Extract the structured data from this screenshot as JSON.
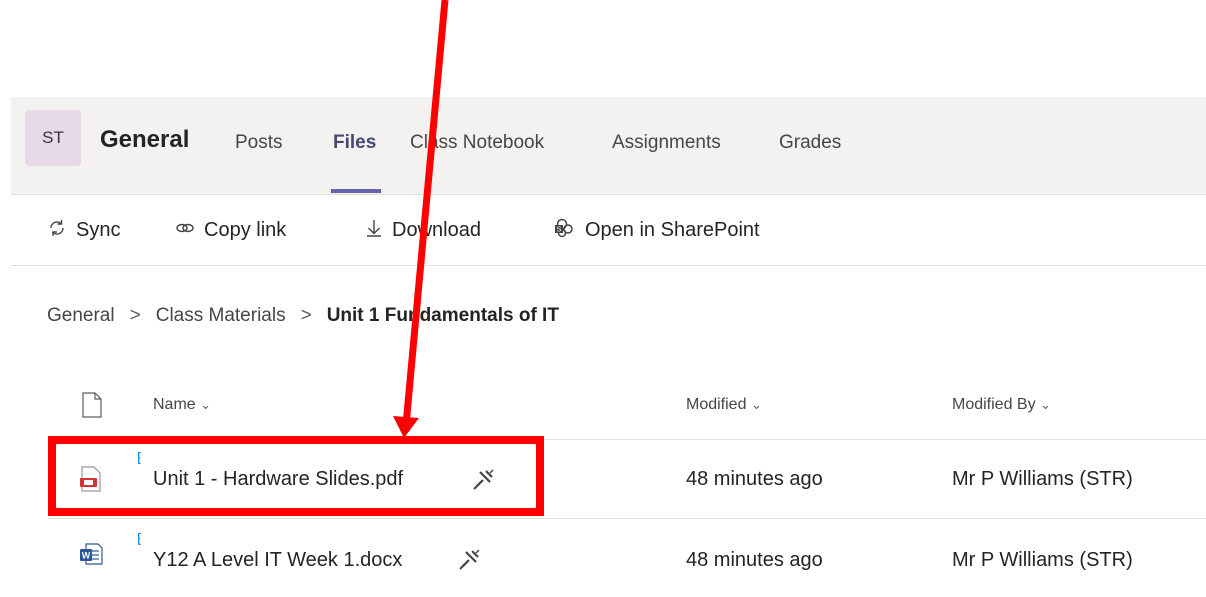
{
  "header": {
    "team_avatar": "ST",
    "channel_name": "General",
    "tabs": [
      {
        "label": "Posts",
        "active": false
      },
      {
        "label": "Files",
        "active": true
      },
      {
        "label": "Class Notebook",
        "active": false
      },
      {
        "label": "Assignments",
        "active": false
      },
      {
        "label": "Grades",
        "active": false
      }
    ]
  },
  "toolbar": {
    "sync_label": "Sync",
    "copy_link_label": "Copy link",
    "download_label": "Download",
    "open_sharepoint_label": "Open in SharePoint"
  },
  "breadcrumb": {
    "items": [
      "General",
      "Class Materials"
    ],
    "current": "Unit 1 Fundamentals of IT"
  },
  "table": {
    "headers": {
      "name": "Name",
      "modified": "Modified",
      "modified_by": "Modified By"
    },
    "rows": [
      {
        "name": "Unit 1 - Hardware Slides.pdf",
        "type_icon": "pdf-file-icon",
        "modified": "48 minutes ago",
        "modified_by": "Mr P Williams (STR)"
      },
      {
        "name": "Y12 A Level IT Week 1.docx",
        "type_icon": "word-file-icon",
        "modified": "48 minutes ago",
        "modified_by": "Mr P Williams (STR)"
      }
    ]
  },
  "annotation": {
    "color": "#ff0000"
  },
  "colors": {
    "accent": "#6264a7",
    "header_bg": "#f3f2f1"
  }
}
